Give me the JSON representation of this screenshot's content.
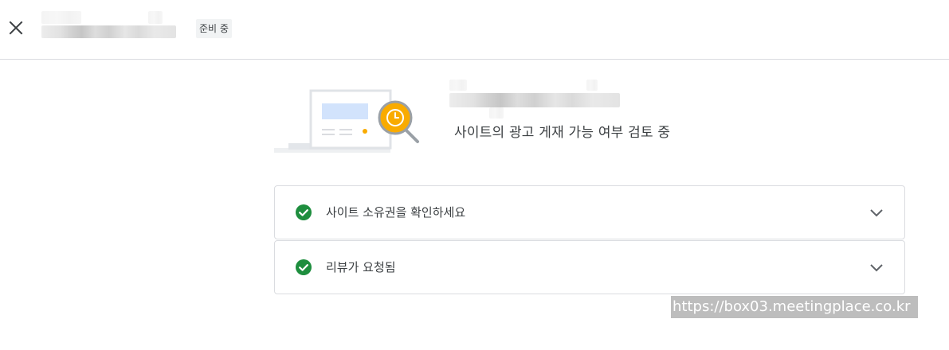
{
  "header": {
    "close_icon": "close-icon",
    "status_badge": "준비 중"
  },
  "review": {
    "illustration_icon": "site-review-magnifier-clock-icon",
    "status_text": "사이트의 광고 게재 가능 여부 검토 중"
  },
  "steps": [
    {
      "label": "사이트 소유권을 확인하세요",
      "status_icon": "check-circle-icon",
      "expand_icon": "chevron-down-icon"
    },
    {
      "label": "리뷰가 요청됨",
      "status_icon": "check-circle-icon",
      "expand_icon": "chevron-down-icon"
    }
  ],
  "watermark": {
    "text": "https://box03.meetingplace.co.kr"
  },
  "colors": {
    "success_green": "#1e8e3e",
    "accent_yellow": "#f9ab00",
    "border": "#dadce0",
    "text": "#3c4043",
    "icon_gray": "#5f6368"
  }
}
